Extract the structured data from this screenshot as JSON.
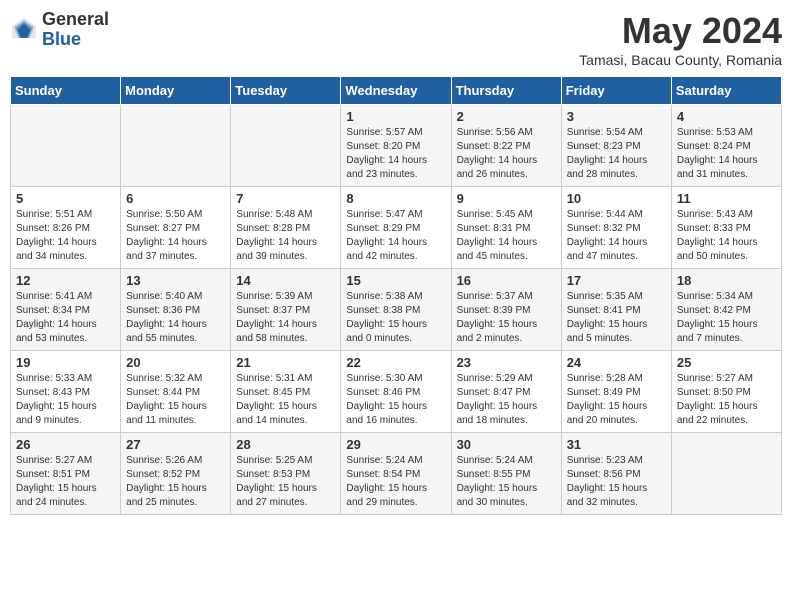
{
  "header": {
    "logo_general": "General",
    "logo_blue": "Blue",
    "month_title": "May 2024",
    "location": "Tamasi, Bacau County, Romania"
  },
  "days_of_week": [
    "Sunday",
    "Monday",
    "Tuesday",
    "Wednesday",
    "Thursday",
    "Friday",
    "Saturday"
  ],
  "weeks": [
    [
      {
        "day": "",
        "info": ""
      },
      {
        "day": "",
        "info": ""
      },
      {
        "day": "",
        "info": ""
      },
      {
        "day": "1",
        "info": "Sunrise: 5:57 AM\nSunset: 8:20 PM\nDaylight: 14 hours\nand 23 minutes."
      },
      {
        "day": "2",
        "info": "Sunrise: 5:56 AM\nSunset: 8:22 PM\nDaylight: 14 hours\nand 26 minutes."
      },
      {
        "day": "3",
        "info": "Sunrise: 5:54 AM\nSunset: 8:23 PM\nDaylight: 14 hours\nand 28 minutes."
      },
      {
        "day": "4",
        "info": "Sunrise: 5:53 AM\nSunset: 8:24 PM\nDaylight: 14 hours\nand 31 minutes."
      }
    ],
    [
      {
        "day": "5",
        "info": "Sunrise: 5:51 AM\nSunset: 8:26 PM\nDaylight: 14 hours\nand 34 minutes."
      },
      {
        "day": "6",
        "info": "Sunrise: 5:50 AM\nSunset: 8:27 PM\nDaylight: 14 hours\nand 37 minutes."
      },
      {
        "day": "7",
        "info": "Sunrise: 5:48 AM\nSunset: 8:28 PM\nDaylight: 14 hours\nand 39 minutes."
      },
      {
        "day": "8",
        "info": "Sunrise: 5:47 AM\nSunset: 8:29 PM\nDaylight: 14 hours\nand 42 minutes."
      },
      {
        "day": "9",
        "info": "Sunrise: 5:45 AM\nSunset: 8:31 PM\nDaylight: 14 hours\nand 45 minutes."
      },
      {
        "day": "10",
        "info": "Sunrise: 5:44 AM\nSunset: 8:32 PM\nDaylight: 14 hours\nand 47 minutes."
      },
      {
        "day": "11",
        "info": "Sunrise: 5:43 AM\nSunset: 8:33 PM\nDaylight: 14 hours\nand 50 minutes."
      }
    ],
    [
      {
        "day": "12",
        "info": "Sunrise: 5:41 AM\nSunset: 8:34 PM\nDaylight: 14 hours\nand 53 minutes."
      },
      {
        "day": "13",
        "info": "Sunrise: 5:40 AM\nSunset: 8:36 PM\nDaylight: 14 hours\nand 55 minutes."
      },
      {
        "day": "14",
        "info": "Sunrise: 5:39 AM\nSunset: 8:37 PM\nDaylight: 14 hours\nand 58 minutes."
      },
      {
        "day": "15",
        "info": "Sunrise: 5:38 AM\nSunset: 8:38 PM\nDaylight: 15 hours\nand 0 minutes."
      },
      {
        "day": "16",
        "info": "Sunrise: 5:37 AM\nSunset: 8:39 PM\nDaylight: 15 hours\nand 2 minutes."
      },
      {
        "day": "17",
        "info": "Sunrise: 5:35 AM\nSunset: 8:41 PM\nDaylight: 15 hours\nand 5 minutes."
      },
      {
        "day": "18",
        "info": "Sunrise: 5:34 AM\nSunset: 8:42 PM\nDaylight: 15 hours\nand 7 minutes."
      }
    ],
    [
      {
        "day": "19",
        "info": "Sunrise: 5:33 AM\nSunset: 8:43 PM\nDaylight: 15 hours\nand 9 minutes."
      },
      {
        "day": "20",
        "info": "Sunrise: 5:32 AM\nSunset: 8:44 PM\nDaylight: 15 hours\nand 11 minutes."
      },
      {
        "day": "21",
        "info": "Sunrise: 5:31 AM\nSunset: 8:45 PM\nDaylight: 15 hours\nand 14 minutes."
      },
      {
        "day": "22",
        "info": "Sunrise: 5:30 AM\nSunset: 8:46 PM\nDaylight: 15 hours\nand 16 minutes."
      },
      {
        "day": "23",
        "info": "Sunrise: 5:29 AM\nSunset: 8:47 PM\nDaylight: 15 hours\nand 18 minutes."
      },
      {
        "day": "24",
        "info": "Sunrise: 5:28 AM\nSunset: 8:49 PM\nDaylight: 15 hours\nand 20 minutes."
      },
      {
        "day": "25",
        "info": "Sunrise: 5:27 AM\nSunset: 8:50 PM\nDaylight: 15 hours\nand 22 minutes."
      }
    ],
    [
      {
        "day": "26",
        "info": "Sunrise: 5:27 AM\nSunset: 8:51 PM\nDaylight: 15 hours\nand 24 minutes."
      },
      {
        "day": "27",
        "info": "Sunrise: 5:26 AM\nSunset: 8:52 PM\nDaylight: 15 hours\nand 25 minutes."
      },
      {
        "day": "28",
        "info": "Sunrise: 5:25 AM\nSunset: 8:53 PM\nDaylight: 15 hours\nand 27 minutes."
      },
      {
        "day": "29",
        "info": "Sunrise: 5:24 AM\nSunset: 8:54 PM\nDaylight: 15 hours\nand 29 minutes."
      },
      {
        "day": "30",
        "info": "Sunrise: 5:24 AM\nSunset: 8:55 PM\nDaylight: 15 hours\nand 30 minutes."
      },
      {
        "day": "31",
        "info": "Sunrise: 5:23 AM\nSunset: 8:56 PM\nDaylight: 15 hours\nand 32 minutes."
      },
      {
        "day": "",
        "info": ""
      }
    ]
  ]
}
